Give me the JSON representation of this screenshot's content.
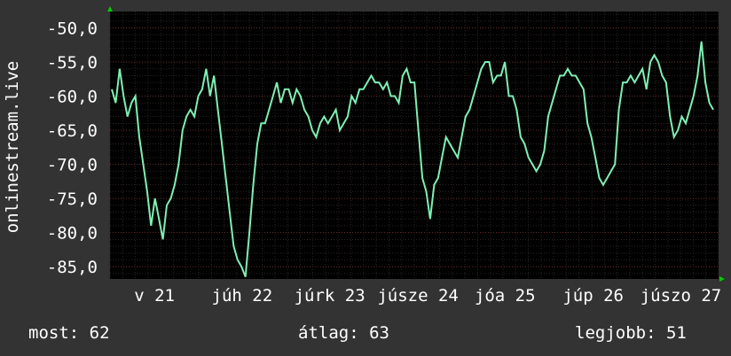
{
  "chart_data": {
    "type": "line",
    "ylabel": "onlinestream.live",
    "ylim": [
      -86.8,
      -47.6
    ],
    "y_ticks": [
      "-50,0",
      "-55,0",
      "-60,0",
      "-65,0",
      "-70,0",
      "-75,0",
      "-80,0",
      "-85,0"
    ],
    "y_tick_values": [
      -50,
      -55,
      -60,
      -65,
      -70,
      -75,
      -80,
      -85
    ],
    "x_ticks": [
      "v 21",
      "júh 22",
      "júrk 23",
      "júsze 24",
      "jóa 25",
      "júp 26",
      "júszo 27"
    ],
    "x_tick_positions": [
      0.073,
      0.217,
      0.361,
      0.506,
      0.649,
      0.794,
      0.938
    ],
    "grid": true,
    "colors": {
      "line": "#7ef0b4",
      "background": "#000000",
      "grid": "#5a2a2a",
      "axis_arrow": "#00cc00"
    },
    "series": [
      {
        "values": [
          -59,
          -61,
          -56,
          -60,
          -63,
          -61,
          -60,
          -66,
          -70,
          -74,
          -79,
          -75,
          -78,
          -81,
          -76,
          -75,
          -73,
          -70,
          -65,
          -63,
          -62,
          -63,
          -60,
          -59,
          -56,
          -60,
          -57,
          -62,
          -67,
          -72,
          -77,
          -82,
          -84,
          -85,
          -86.5,
          -80,
          -73,
          -67,
          -64,
          -64,
          -62,
          -60,
          -58,
          -61,
          -59,
          -59,
          -61,
          -59,
          -60,
          -62,
          -63,
          -65,
          -66,
          -64,
          -63,
          -64,
          -63,
          -62,
          -65,
          -64,
          -63,
          -60,
          -61,
          -59,
          -59,
          -58,
          -57,
          -58,
          -58,
          -59,
          -58,
          -60,
          -60,
          -61,
          -57,
          -56,
          -58,
          -58,
          -65,
          -72,
          -74,
          -78,
          -73,
          -72,
          -69,
          -66,
          -67,
          -68,
          -69,
          -66,
          -63,
          -62,
          -60,
          -58,
          -56,
          -55,
          -55,
          -58,
          -57,
          -57,
          -55,
          -60,
          -60,
          -62,
          -66,
          -67,
          -69,
          -70,
          -71,
          -70,
          -68,
          -63,
          -61,
          -59,
          -57,
          -57,
          -56,
          -57,
          -57,
          -58,
          -59,
          -64,
          -66,
          -69,
          -72,
          -73,
          -72,
          -71,
          -70,
          -62,
          -58,
          -58,
          -57,
          -58,
          -57,
          -56,
          -59,
          -55,
          -54,
          -55,
          -57,
          -58,
          -63,
          -66,
          -65,
          -63,
          -64,
          -62,
          -60,
          -57,
          -52,
          -58,
          -61,
          -62
        ]
      }
    ]
  },
  "stats": {
    "current": "most: 62",
    "average": "átlag: 63",
    "best": "legjobb: 51"
  }
}
